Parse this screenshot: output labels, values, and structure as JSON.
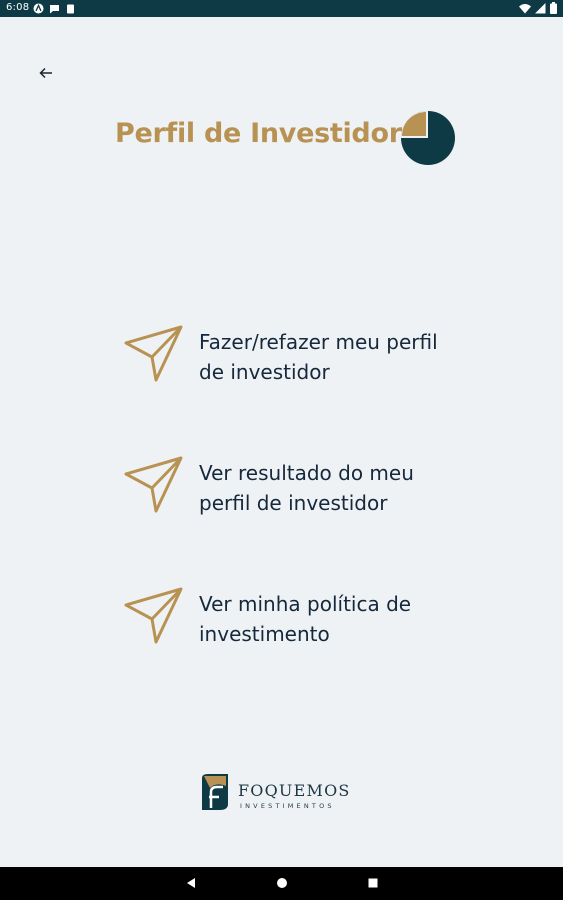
{
  "status_bar": {
    "time": "6:08",
    "notification_icons": [
      "android-auto-icon",
      "chat-bubble-icon",
      "clipboard-icon"
    ],
    "right_icons": [
      "wifi-icon",
      "signal-icon",
      "battery-icon"
    ]
  },
  "header": {
    "back_icon": "arrow-left-icon",
    "title": "Perfil de Investidor",
    "pie_icon": "pie-chart-icon"
  },
  "options": [
    {
      "label": "Fazer/refazer meu perfil de investidor",
      "icon": "paper-plane-icon"
    },
    {
      "label": "Ver resultado do meu perfil de investidor",
      "icon": "paper-plane-icon"
    },
    {
      "label": "Ver minha política de investimento",
      "icon": "paper-plane-icon"
    }
  ],
  "logo": {
    "brand": "FOQUEMOS",
    "sub": "INVESTIMENTOS"
  },
  "colors": {
    "accent": "#b89252",
    "dark": "#0e3a46",
    "text": "#15283c",
    "background": "#eff2f5"
  },
  "nav_bar": [
    "back-triangle-icon",
    "home-circle-icon",
    "recents-square-icon"
  ]
}
